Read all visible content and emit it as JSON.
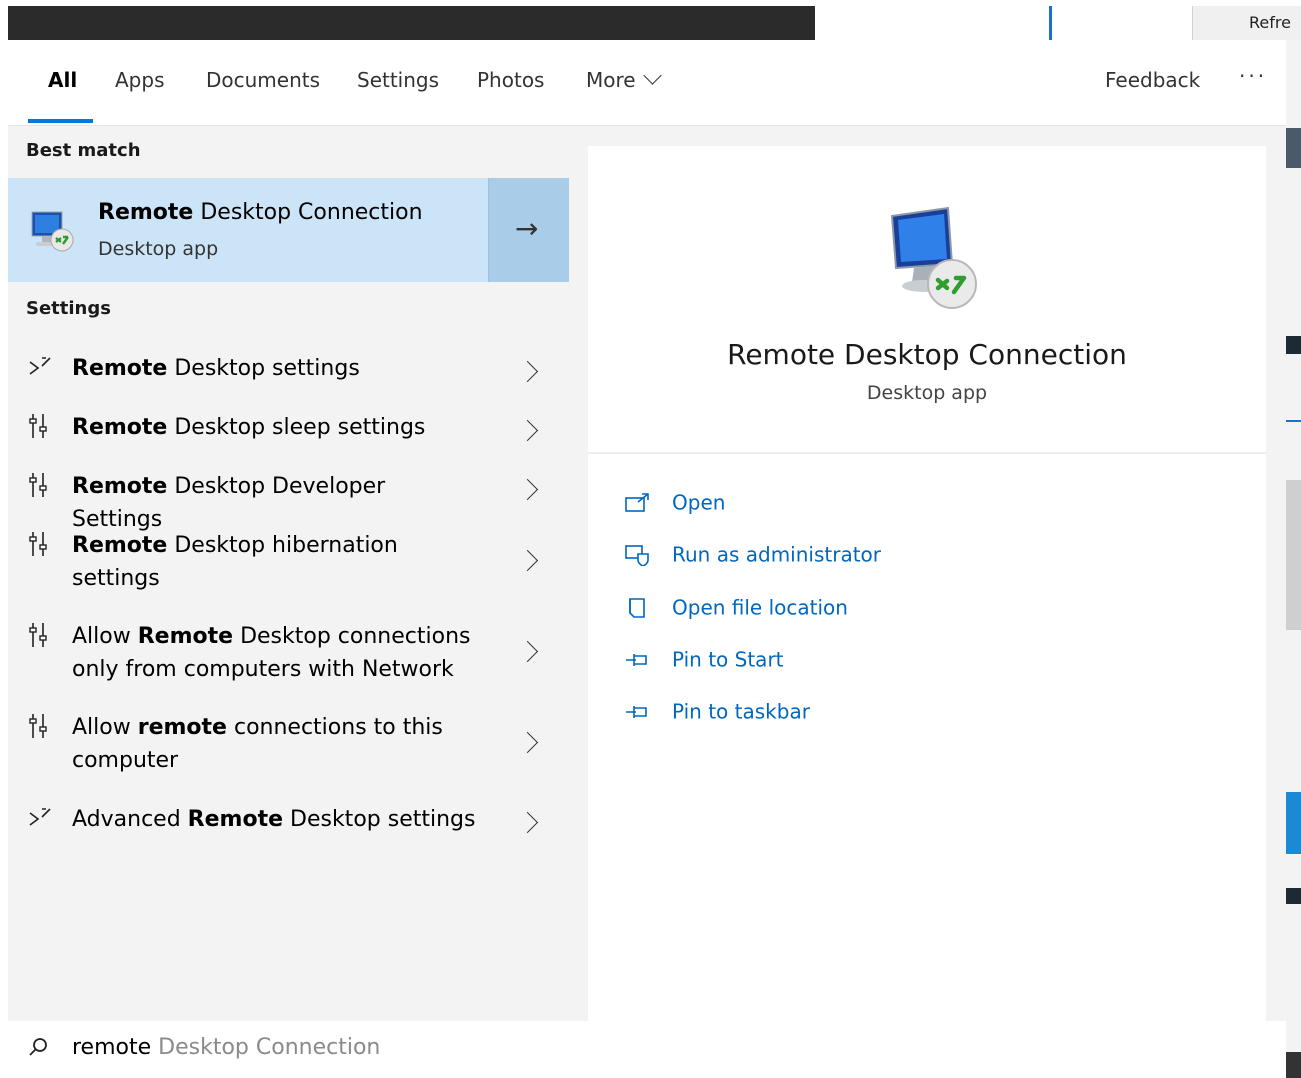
{
  "background": {
    "refresh_label": "Refre"
  },
  "tabs": [
    {
      "label": "All"
    },
    {
      "label": "Apps"
    },
    {
      "label": "Documents"
    },
    {
      "label": "Settings"
    },
    {
      "label": "Photos"
    },
    {
      "label": "More"
    }
  ],
  "feedback_label": "Feedback",
  "more_options_label": "···",
  "best_match": {
    "heading": "Best match",
    "title_bold": "Remote",
    "title_rest": " Desktop Connection",
    "subtitle": "Desktop app"
  },
  "settings": {
    "heading": "Settings",
    "items": [
      {
        "pre": "",
        "bold": "Remote",
        "post": " Desktop settings",
        "icon": "remote-desktop-icon"
      },
      {
        "pre": "",
        "bold": "Remote",
        "post": " Desktop sleep settings",
        "icon": "settings-sliders-icon"
      },
      {
        "pre": "",
        "bold": "Remote",
        "post": " Desktop Developer Settings",
        "icon": "settings-sliders-icon"
      },
      {
        "pre": "",
        "bold": "Remote",
        "post": " Desktop hibernation settings",
        "icon": "settings-sliders-icon"
      },
      {
        "pre": "Allow ",
        "bold": "Remote",
        "post": " Desktop connections only from computers with Network",
        "icon": "settings-sliders-icon"
      },
      {
        "pre": "Allow ",
        "bold": "remote",
        "post": " connections to this computer",
        "icon": "settings-sliders-icon"
      },
      {
        "pre": "Advanced ",
        "bold": "Remote",
        "post": " Desktop settings",
        "icon": "remote-desktop-icon"
      }
    ]
  },
  "detail": {
    "title": "Remote Desktop Connection",
    "subtitle": "Desktop app",
    "actions": [
      {
        "label": "Open",
        "icon": "open-icon"
      },
      {
        "label": "Run as administrator",
        "icon": "run-as-admin-icon"
      },
      {
        "label": "Open file location",
        "icon": "folder-location-icon"
      },
      {
        "label": "Pin to Start",
        "icon": "pin-icon"
      },
      {
        "label": "Pin to taskbar",
        "icon": "pin-icon"
      }
    ]
  },
  "search": {
    "typed": "remote",
    "suggestion": " Desktop Connection"
  },
  "colors": {
    "accent": "#0078d7",
    "link": "#0067c0",
    "selected_bg": "#cce4f7"
  }
}
